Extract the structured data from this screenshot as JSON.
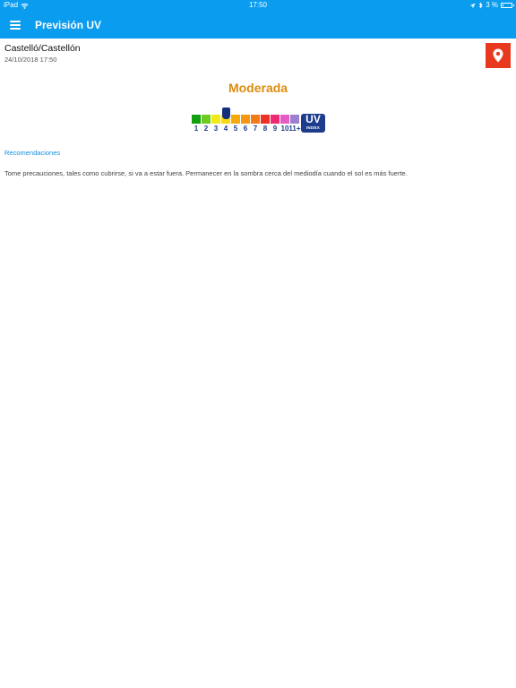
{
  "status_bar": {
    "device": "iPad",
    "time": "17:50",
    "battery": "3 %",
    "icons": [
      "wifi-icon",
      "location-arrow-icon",
      "bluetooth-icon",
      "battery-icon"
    ]
  },
  "app_bar": {
    "title": "Previsión UV",
    "menu_icon": "hamburger-menu-icon"
  },
  "location": {
    "name": "Castelló/Castellón",
    "datetime": "24/10/2018 17:50",
    "button_icon": "map-pin-icon",
    "button_color": "#e8391e"
  },
  "uv": {
    "level_label": "Moderada",
    "level_color": "#dd8c0e",
    "current_index": 4,
    "scale": [
      {
        "label": "1",
        "color": "#11a00f"
      },
      {
        "label": "2",
        "color": "#6ccb1b"
      },
      {
        "label": "3",
        "color": "#f2ea18"
      },
      {
        "label": "4",
        "color": "#f8d80f"
      },
      {
        "label": "5",
        "color": "#f6a90c"
      },
      {
        "label": "6",
        "color": "#f69612"
      },
      {
        "label": "7",
        "color": "#f27a18"
      },
      {
        "label": "8",
        "color": "#ee3125"
      },
      {
        "label": "9",
        "color": "#ec2a74"
      },
      {
        "label": "10",
        "color": "#e45bc1"
      },
      {
        "label": "11+",
        "color": "#9c7fcf"
      }
    ],
    "index_badge": {
      "main": "UV",
      "sub": "INDEX",
      "color": "#1d3c8c"
    }
  },
  "recommendations": {
    "title": "Recomendaciones",
    "text": "Tome precauciones, tales como cubrirse, si va a estar fuera. Permanecer en la sombra cerca del mediodía cuando el sol es más fuerte."
  }
}
